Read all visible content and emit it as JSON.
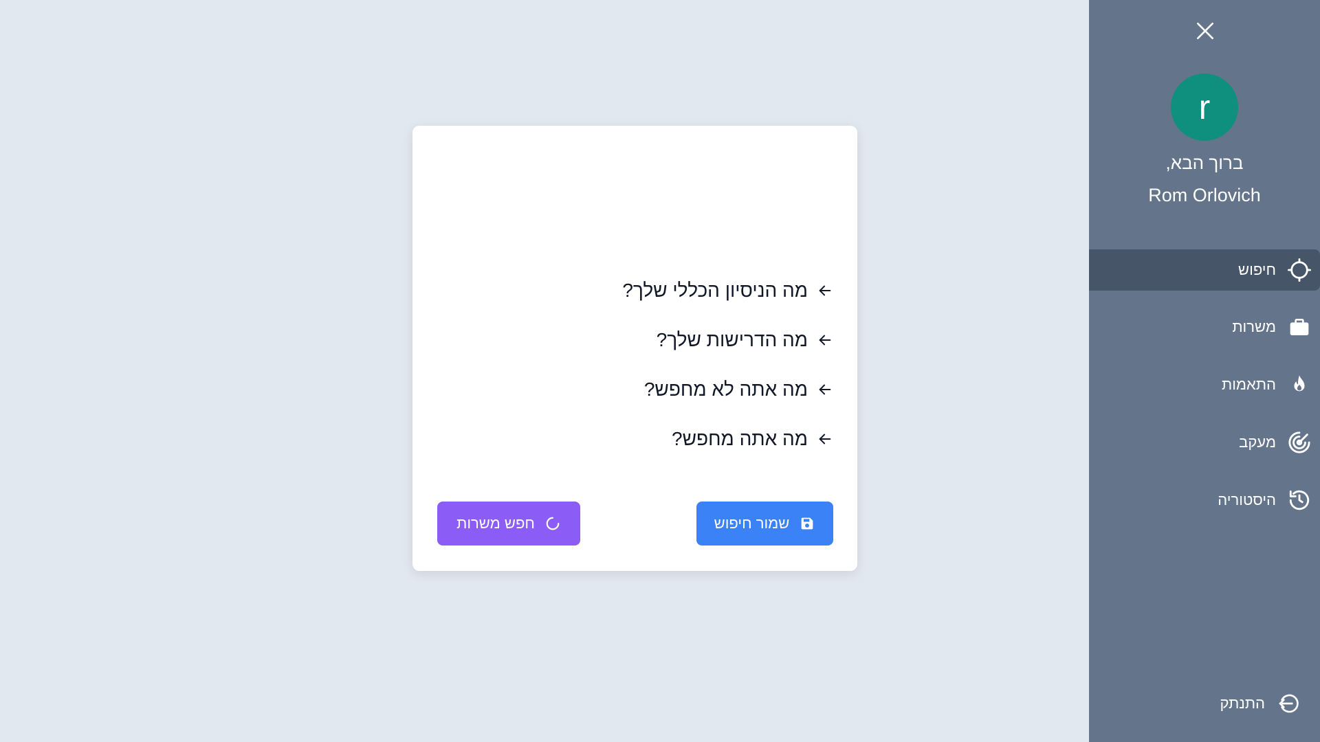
{
  "sidebar": {
    "close_icon": "close-icon",
    "avatar_letter": "r",
    "avatar_color": "#0f8f7e",
    "welcome": "ברוך הבא,",
    "username": "Rom Orlovich",
    "items": [
      {
        "label": "חיפוש",
        "icon": "crosshair-icon",
        "active": true
      },
      {
        "label": "משרות",
        "icon": "briefcase-icon",
        "active": false
      },
      {
        "label": "התאמות",
        "icon": "flame-icon",
        "active": false
      },
      {
        "label": "מעקב",
        "icon": "target-icon",
        "active": false
      },
      {
        "label": "היסטוריה",
        "icon": "history-icon",
        "active": false
      }
    ],
    "logout_label": "התנתק",
    "background": "#64748b",
    "active_background": "#475569"
  },
  "card": {
    "questions": [
      "מה הניסיון הכללי שלך?",
      "מה הדרישות שלך?",
      "מה אתה לא מחפש?",
      "מה אתה מחפש?"
    ],
    "save_button": {
      "label": "שמור חיפוש",
      "icon": "save-icon",
      "color": "#3b82f6"
    },
    "search_button": {
      "label": "חפש משרות",
      "icon": "spinner-icon",
      "color": "#8b5cf6"
    }
  },
  "page_background": "#e2e8f0"
}
